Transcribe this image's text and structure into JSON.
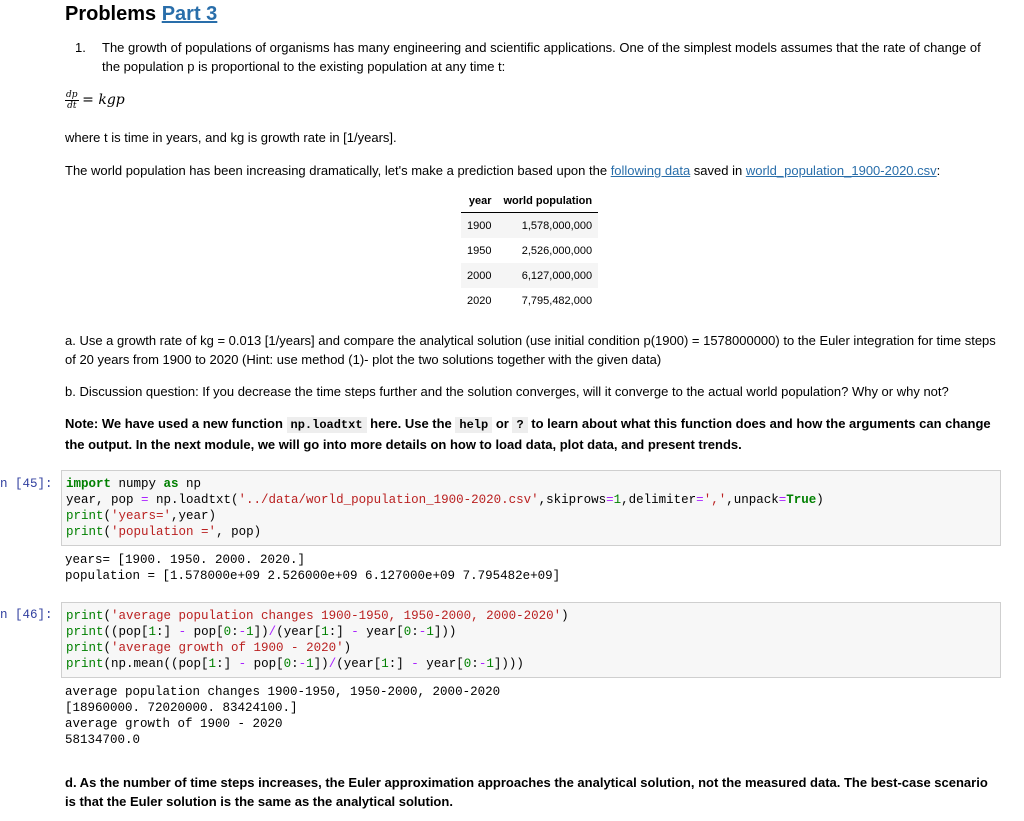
{
  "header": {
    "title": "Problems",
    "title_link": "Part 3"
  },
  "intro": {
    "item_number": "1.",
    "text": "The growth of populations of organisms has many engineering and scientific applications. One of the simplest models assumes that the rate of change of the population p is proportional to the existing population at any time t:",
    "eq_num": "dp",
    "eq_den": "dt",
    "eq_rhs": "= kgp",
    "where_text": "where t is time in years, and kg is growth rate in [1/years].",
    "world_pre": "The world population has been increasing dramatically, let's make a prediction based upon the ",
    "link1": "following data",
    "world_mid": " saved in ",
    "link2": "world_population_1900-2020.csv",
    "world_post": ":"
  },
  "table": {
    "headers": [
      "year",
      "world population"
    ],
    "rows": [
      [
        "1900",
        "1,578,000,000"
      ],
      [
        "1950",
        "2,526,000,000"
      ],
      [
        "2000",
        "6,127,000,000"
      ],
      [
        "2020",
        "7,795,482,000"
      ]
    ]
  },
  "questions": {
    "a": "a. Use a growth rate of kg = 0.013 [1/years] and compare the analytical solution (use initial condition p(1900) = 1578000000) to the Euler integration for time steps of 20 years from 1900 to 2020 (Hint: use method (1)- plot the two solutions together with the given data)",
    "b": "b. Discussion question: If you decrease the time steps further and the solution converges, will it converge to the actual world population? Why or why not?",
    "note_1": "Note: We have used a new function ",
    "note_code1": "np.loadtxt",
    "note_2": " here. Use the ",
    "note_code2": "help",
    "note_3": " or ",
    "note_code3": "?",
    "note_4": " to learn about what this function does and how the arguments can change the output. In the next module, we will go into more details on how to load data, plot data, and present trends."
  },
  "cell45": {
    "prompt": "n [45]:",
    "output_lines": [
      "years= [1900. 1950. 2000. 2020.]",
      "population = [1.578000e+09 2.526000e+09 6.127000e+09 7.795482e+09]"
    ]
  },
  "cell46": {
    "prompt": "n [46]:",
    "output_lines": [
      "average population changes 1900-1950, 1950-2000, 2000-2020",
      "[18960000. 72020000. 83424100.]",
      "average growth of 1900 - 2020",
      "58134700.0"
    ]
  },
  "answer_d": "d. As the number of time steps increases, the Euler approximation approaches the analytical solution, not the measured data. The best-case scenario is that the Euler solution is the same as the analytical solution."
}
